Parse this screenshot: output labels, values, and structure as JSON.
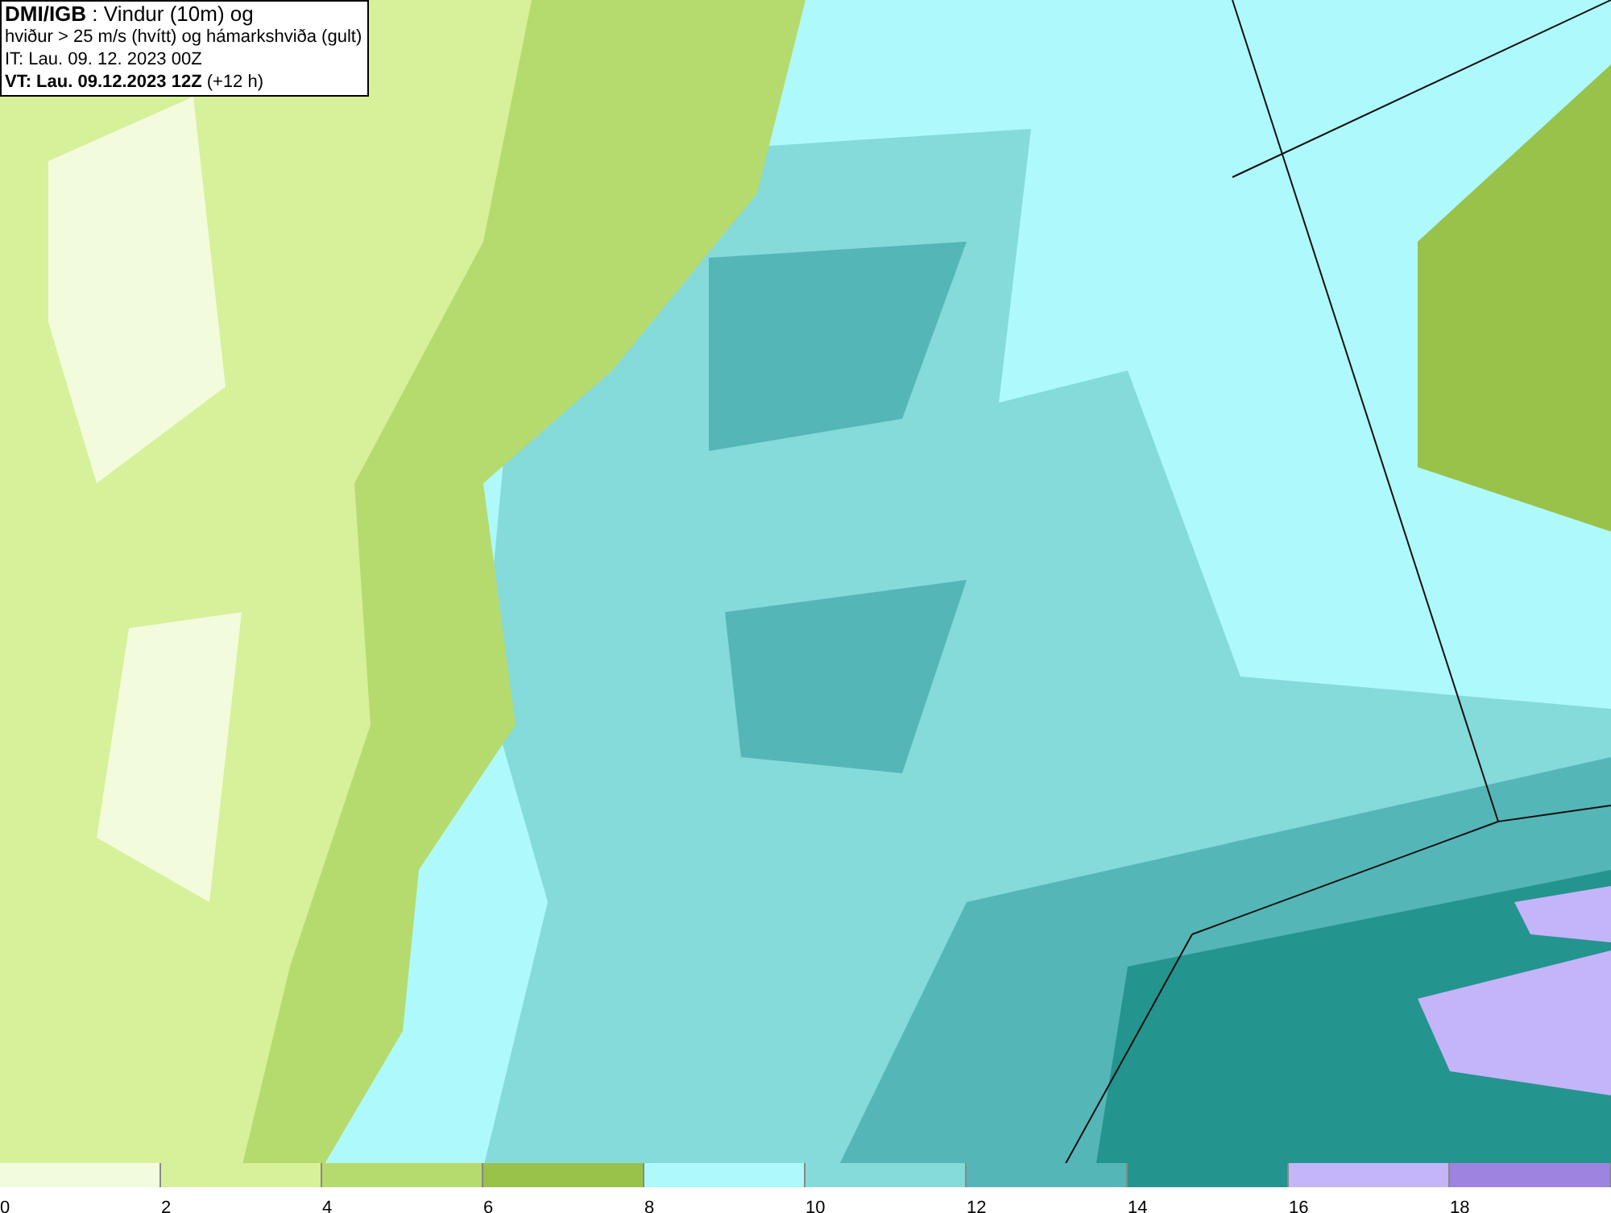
{
  "info_box": {
    "lines": [
      "**DMI/IGB** : Vindur (10m) og",
      "hviður > 25 m/s (hvítt) og hámarkshviða (gult)",
      "IT: Lau. 09. 12. 2023 00Z",
      "**VT: Lau. 09.12.2023 12Z** (+12 h)"
    ]
  },
  "legend": [
    {
      "label": "0",
      "color": "#f2fcdc"
    },
    {
      "label": "2",
      "color": "#d7f09a"
    },
    {
      "label": "4",
      "color": "#b5db6e"
    },
    {
      "label": "6",
      "color": "#99c24a"
    },
    {
      "label": "8",
      "color": "#aef9fb"
    },
    {
      "label": "10",
      "color": "#85dada"
    },
    {
      "label": "12",
      "color": "#55b6b8"
    },
    {
      "label": "14",
      "color": "#24948f"
    },
    {
      "label": "16",
      "color": "#c4b4f8"
    },
    {
      "label": "18",
      "color": "#9e84e0"
    }
  ]
}
